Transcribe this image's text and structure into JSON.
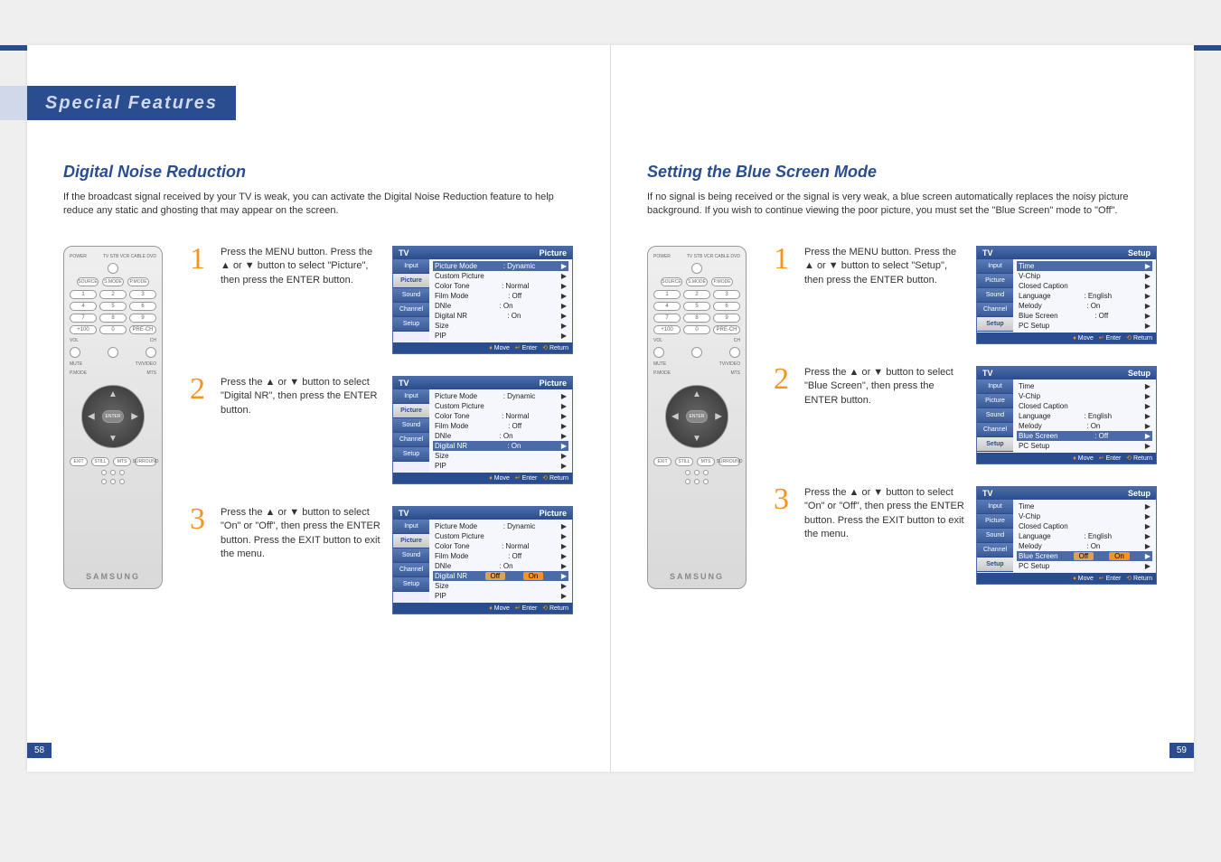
{
  "chapter": "Special Features",
  "left": {
    "section_title": "Digital Noise Reduction",
    "intro": "If the broadcast signal received by your TV is weak, you can activate the Digital Noise Reduction feature to help reduce any static and ghosting that may appear on the screen.",
    "page_num": "58",
    "steps": [
      {
        "num": "1",
        "text": "Press the MENU button. Press the ▲ or ▼ button to select \"Picture\", then press the ENTER button.",
        "osd_title": "Picture",
        "side_active": "Picture",
        "rows": [
          {
            "label": "Picture Mode",
            "value": ": Dynamic",
            "hl": true
          },
          {
            "label": "Custom Picture",
            "value": ""
          },
          {
            "label": "Color Tone",
            "value": ": Normal"
          },
          {
            "label": "Film Mode",
            "value": ": Off"
          },
          {
            "label": "DNIe",
            "value": ": On"
          },
          {
            "label": "Digital NR",
            "value": ": On"
          },
          {
            "label": "Size",
            "value": ""
          },
          {
            "label": "PIP",
            "value": ""
          }
        ]
      },
      {
        "num": "2",
        "text": "Press the ▲ or ▼ button to select \"Digital NR\", then press the ENTER button.",
        "osd_title": "Picture",
        "side_active": "Picture",
        "rows": [
          {
            "label": "Picture Mode",
            "value": ": Dynamic"
          },
          {
            "label": "Custom Picture",
            "value": ""
          },
          {
            "label": "Color Tone",
            "value": ": Normal"
          },
          {
            "label": "Film Mode",
            "value": ": Off"
          },
          {
            "label": "DNIe",
            "value": ": On"
          },
          {
            "label": "Digital NR",
            "value": ": On",
            "hl": true
          },
          {
            "label": "Size",
            "value": ""
          },
          {
            "label": "PIP",
            "value": ""
          }
        ]
      },
      {
        "num": "3",
        "text": "Press the ▲ or ▼ button to select \"On\" or \"Off\", then press the ENTER button. Press the EXIT button to exit the menu.",
        "osd_title": "Picture",
        "side_active": "Picture",
        "rows": [
          {
            "label": "Picture Mode",
            "value": ": Dynamic"
          },
          {
            "label": "Custom Picture",
            "value": ""
          },
          {
            "label": "Color Tone",
            "value": ": Normal"
          },
          {
            "label": "Film Mode",
            "value": ": Off"
          },
          {
            "label": "DNIe",
            "value": ": On"
          },
          {
            "label": "Digital NR",
            "value": "",
            "opts": [
              "Off",
              "On"
            ],
            "hl": true
          },
          {
            "label": "Size",
            "value": ""
          },
          {
            "label": "PIP",
            "value": ""
          }
        ]
      }
    ]
  },
  "right": {
    "section_title": "Setting the Blue Screen Mode",
    "intro": "If no signal is being received or the signal is very weak, a blue screen automatically replaces the noisy picture background. If you wish to continue viewing the poor picture, you must set the \"Blue Screen\" mode to \"Off\".",
    "page_num": "59",
    "steps": [
      {
        "num": "1",
        "text": "Press the MENU button. Press the ▲ or ▼ button to select \"Setup\", then press the ENTER button.",
        "osd_title": "Setup",
        "side_active": "Setup",
        "rows": [
          {
            "label": "Time",
            "value": "",
            "hl": true
          },
          {
            "label": "V-Chip",
            "value": ""
          },
          {
            "label": "Closed Caption",
            "value": ""
          },
          {
            "label": "Language",
            "value": ": English"
          },
          {
            "label": "Melody",
            "value": ": On"
          },
          {
            "label": "Blue Screen",
            "value": ": Off"
          },
          {
            "label": "PC Setup",
            "value": ""
          }
        ]
      },
      {
        "num": "2",
        "text": "Press the ▲ or ▼ button to select \"Blue Screen\", then press the ENTER button.",
        "osd_title": "Setup",
        "side_active": "Setup",
        "rows": [
          {
            "label": "Time",
            "value": ""
          },
          {
            "label": "V-Chip",
            "value": ""
          },
          {
            "label": "Closed Caption",
            "value": ""
          },
          {
            "label": "Language",
            "value": ": English"
          },
          {
            "label": "Melody",
            "value": ": On"
          },
          {
            "label": "Blue Screen",
            "value": ": Off",
            "hl": true
          },
          {
            "label": "PC Setup",
            "value": ""
          }
        ]
      },
      {
        "num": "3",
        "text": "Press the ▲ or ▼ button to select \"On\" or \"Off\", then press the ENTER button. Press the EXIT button to exit the menu.",
        "osd_title": "Setup",
        "side_active": "Setup",
        "rows": [
          {
            "label": "Time",
            "value": ""
          },
          {
            "label": "V-Chip",
            "value": ""
          },
          {
            "label": "Closed Caption",
            "value": ""
          },
          {
            "label": "Language",
            "value": ": English"
          },
          {
            "label": "Melody",
            "value": ": On"
          },
          {
            "label": "Blue Screen",
            "value": "",
            "opts": [
              "Off",
              "On"
            ],
            "hl": true
          },
          {
            "label": "PC Setup",
            "value": ""
          }
        ]
      }
    ]
  },
  "osd_side": [
    "Input",
    "Picture",
    "Sound",
    "Channel",
    "Setup"
  ],
  "osd_footer": {
    "move": "Move",
    "enter": "Enter",
    "return": "Return"
  },
  "remote": {
    "power": "POWER",
    "sources": "TV  STB  VCR  CABLE  DVD",
    "row2": [
      "SOURCE",
      "S.MODE",
      "P.MODE"
    ],
    "nums": [
      "1",
      "2",
      "3",
      "4",
      "5",
      "6",
      "7",
      "8",
      "9",
      "+100",
      "0",
      "PRE-CH"
    ],
    "vol": "VOL",
    "ch": "CH",
    "mute": "MUTE",
    "tvvideo": "TV/VIDEO",
    "pmode": "P.MODE",
    "mts": "MTS",
    "enter": "ENTER",
    "bottom": [
      "EXIT",
      "STILL",
      "MTS",
      "SURROUND"
    ],
    "logo": "SAMSUNG"
  }
}
